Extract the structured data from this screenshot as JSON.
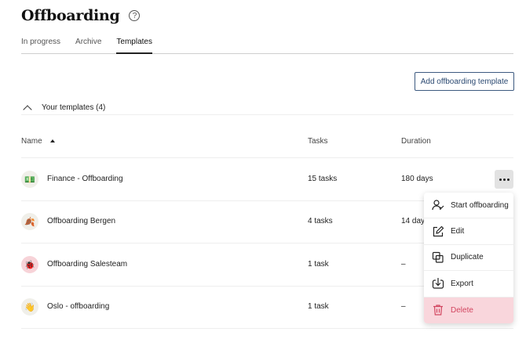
{
  "header": {
    "title": "Offboarding",
    "help_icon": "?"
  },
  "tabs": [
    {
      "label": "In progress",
      "active": false
    },
    {
      "label": "Archive",
      "active": false
    },
    {
      "label": "Templates",
      "active": true
    }
  ],
  "toolbar": {
    "add_label": "Add offboarding template"
  },
  "section": {
    "label": "Your templates (4)",
    "expanded": true
  },
  "table": {
    "columns": {
      "name": "Name",
      "tasks": "Tasks",
      "duration": "Duration"
    },
    "sort": {
      "column": "name",
      "direction": "ascending"
    },
    "rows": [
      {
        "icon": "💵",
        "name": "Finance - Offboarding",
        "tasks": "15 tasks",
        "duration": "180 days"
      },
      {
        "icon": "🍂",
        "name": "Offboarding Bergen",
        "tasks": "4 tasks",
        "duration": "14 days"
      },
      {
        "icon": "🐞",
        "name": "Offboarding Salesteam",
        "tasks": "1 task",
        "duration": "–"
      },
      {
        "icon": "👋",
        "name": "Oslo - offboarding",
        "tasks": "1 task",
        "duration": "–"
      }
    ]
  },
  "context_menu": {
    "items": [
      {
        "label": "Start offboarding",
        "icon": "user-check-icon"
      },
      {
        "label": "Edit",
        "icon": "edit-icon"
      },
      {
        "label": "Duplicate",
        "icon": "duplicate-icon"
      },
      {
        "label": "Export",
        "icon": "export-icon"
      },
      {
        "label": "Delete",
        "icon": "trash-icon",
        "color": "#d24660"
      }
    ]
  },
  "colors": {
    "accent": "#2c4a72",
    "danger": "#d24660",
    "danger_bg": "#f9d6dc"
  }
}
